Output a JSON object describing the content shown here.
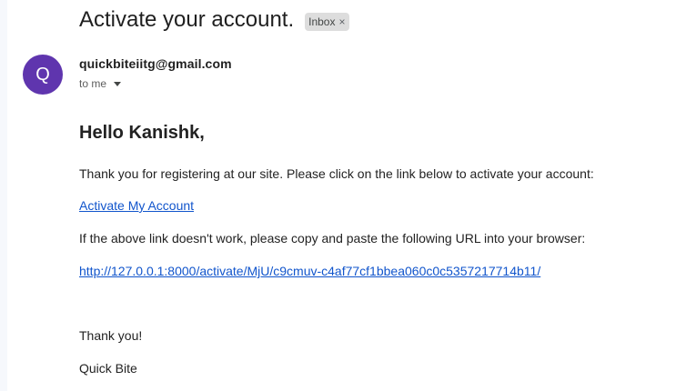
{
  "email": {
    "subject": "Activate your account.",
    "label": "Inbox",
    "label_remove_glyph": "×",
    "sender": {
      "avatar_letter": "Q",
      "avatar_color": "#5f35ae",
      "address": "quickbiteiitg@gmail.com",
      "recipient": "to me"
    },
    "body": {
      "greeting": "Hello Kanishk,",
      "intro": "Thank you for registering at our site. Please click on the link below to activate your account:",
      "activate_link": "Activate My Account",
      "fallback_text": "If the above link doesn't work, please copy and paste the following URL into your browser:",
      "activation_url": "http://127.0.0.1:8000/activate/MjU/c9cmuv-c4af77cf1bbea060c0c5357217714b11/",
      "thanks": "Thank you!",
      "signature": "Quick Bite"
    }
  },
  "colors": {
    "link": "#1155cc",
    "text": "#222222",
    "chip_bg": "#dddddd"
  },
  "icons": {
    "recipient_details": "chevron-down-icon",
    "label_remove": "close-icon"
  }
}
